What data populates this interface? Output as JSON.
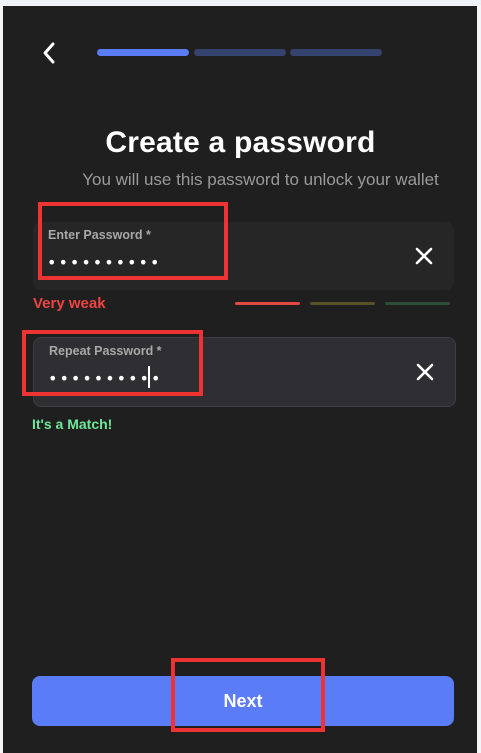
{
  "header": {
    "back_icon": "chevron-left-icon",
    "steps": [
      {
        "state": "active",
        "color": "#5b7cf7"
      },
      {
        "state": "inactive",
        "color": "#34446e"
      },
      {
        "state": "inactive",
        "color": "#34446e"
      }
    ]
  },
  "title": "Create a password",
  "subtitle": "You will use this password to unlock your wallet",
  "password_field": {
    "label": "Enter Password *",
    "value": "••••••••••",
    "clear_icon": "close-icon"
  },
  "strength": {
    "text": "Very weak",
    "level": 1,
    "max": 3,
    "bar_colors": [
      "#e5483f",
      "#5a5227",
      "#2b4d39"
    ]
  },
  "repeat_field": {
    "label": "Repeat Password *",
    "value": "••••••••••",
    "clear_icon": "close-icon"
  },
  "match_text": "It's a Match!",
  "next_label": "Next",
  "colors": {
    "accent": "#5b7cf7",
    "error": "#ef4444",
    "success": "#6ee79a",
    "highlight": "#ee3333"
  }
}
